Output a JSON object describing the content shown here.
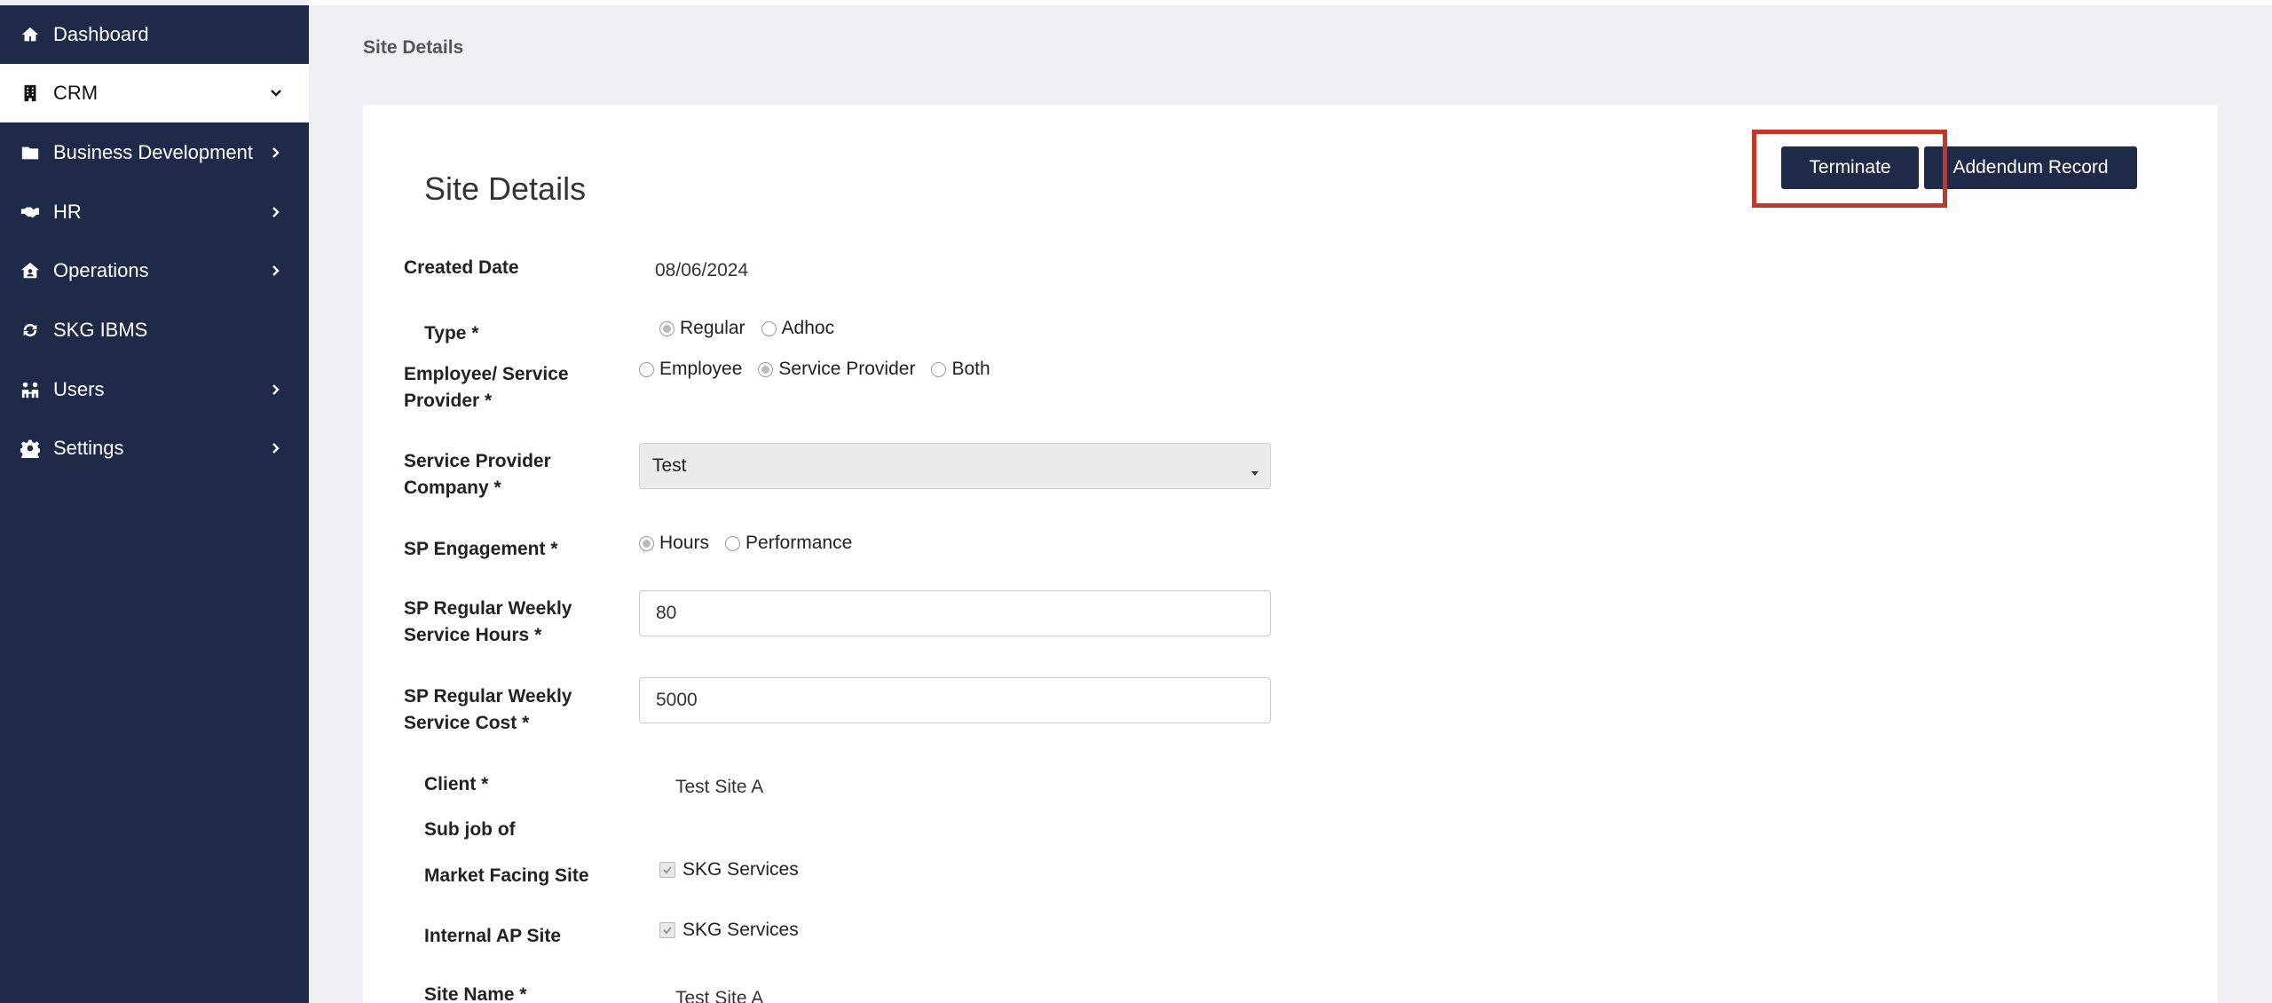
{
  "sidebar": {
    "items": [
      {
        "label": "Dashboard",
        "icon": "home-icon"
      },
      {
        "label": "CRM",
        "icon": "building-icon"
      },
      {
        "label": "Business Development",
        "icon": "folder-icon"
      },
      {
        "label": "HR",
        "icon": "handshake-icon"
      },
      {
        "label": "Operations",
        "icon": "house-user-icon"
      },
      {
        "label": "SKG IBMS",
        "icon": "sync-icon"
      },
      {
        "label": "Users",
        "icon": "users-icon"
      },
      {
        "label": "Settings",
        "icon": "gear-icon"
      }
    ]
  },
  "header": {
    "crumb": "Site Details"
  },
  "main": {
    "title": "Site Details",
    "buttons": {
      "terminate": "Terminate",
      "addendum": "Addendum Record"
    },
    "fields": {
      "created_date": {
        "label": "Created Date",
        "value": "08/06/2024"
      },
      "type": {
        "label": "Type *",
        "options": [
          "Regular",
          "Adhoc"
        ],
        "selected": "Regular"
      },
      "employee_sp": {
        "label_line1": "Employee/ Service",
        "label_line2": "Provider *",
        "options": [
          "Employee",
          "Service Provider",
          "Both"
        ],
        "selected": "Service Provider"
      },
      "sp_company": {
        "label_line1": "Service Provider",
        "label_line2": "Company *",
        "value": "Test"
      },
      "sp_engagement": {
        "label": "SP Engagement *",
        "options": [
          "Hours",
          "Performance"
        ],
        "selected": "Hours"
      },
      "sp_hours": {
        "label_line1": "SP Regular Weekly",
        "label_line2": "Service Hours *",
        "value": "80"
      },
      "sp_cost": {
        "label_line1": "SP Regular Weekly",
        "label_line2": "Service Cost *",
        "value": "5000"
      },
      "client": {
        "label": "Client *",
        "value": "Test Site A"
      },
      "sub_job": {
        "label": "Sub job of"
      },
      "market_facing": {
        "label": "Market Facing Site",
        "value": "SKG Services"
      },
      "internal_ap": {
        "label": "Internal AP Site",
        "value": "SKG Services"
      },
      "site_name": {
        "label": "Site Name *",
        "value": "Test Site A"
      }
    }
  },
  "colors": {
    "sidebar": "#1f2a48",
    "button": "#1f2a48",
    "highlight": "#c0392b",
    "background": "#eef0f5"
  }
}
